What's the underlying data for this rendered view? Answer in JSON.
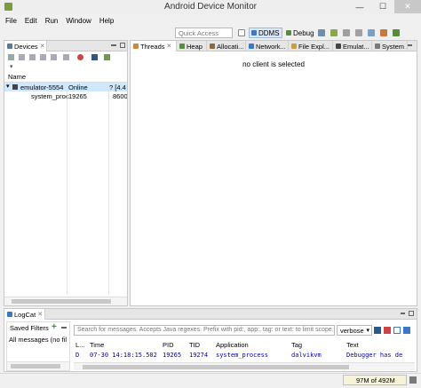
{
  "window": {
    "title": "Android Device Monitor",
    "minimize": "—",
    "maximize": "☐",
    "close": "✕"
  },
  "menu": [
    "File",
    "Edit",
    "Run",
    "Window",
    "Help"
  ],
  "quick_access": {
    "placeholder": "Quick Access"
  },
  "perspectives": [
    {
      "label": "DDMS",
      "active": true
    },
    {
      "label": "Debug",
      "active": false
    }
  ],
  "devices": {
    "tab_label": "Devices",
    "column_header": "Name",
    "rows": [
      {
        "name": "emulator-5554",
        "col2": "Online",
        "col3": "? [4.4"
      },
      {
        "name": "system_proc",
        "col2": "19265",
        "col3": "8600"
      }
    ]
  },
  "right_tabs": [
    "Threads",
    "Heap",
    "Allocati...",
    "Network...",
    "File Expl...",
    "Emulat...",
    "System ..."
  ],
  "main_message": "no client is selected",
  "logcat": {
    "tab_label": "LogCat",
    "saved_filters_label": "Saved Filters",
    "filters": [
      "All messages (no fil"
    ],
    "search_placeholder": "Search for messages. Accepts Java regexes. Prefix with pid:, app:, tag: or text: to limit scope.",
    "level": "verbose",
    "columns": [
      "L...",
      "Time",
      "PID",
      "TID",
      "Application",
      "Tag",
      "Text"
    ],
    "rows": [
      {
        "level": "D",
        "time": "07-30 14:18:15.502",
        "pid": "19265",
        "tid": "19274",
        "app": "system_process",
        "tag": "dalvikvm",
        "text": "Debugger has de"
      }
    ]
  },
  "status": {
    "memory": "97M of 492M"
  },
  "colors": {
    "selection": "#cde8ff",
    "log_text": "#0000b8",
    "accent": "#3c78c8"
  }
}
